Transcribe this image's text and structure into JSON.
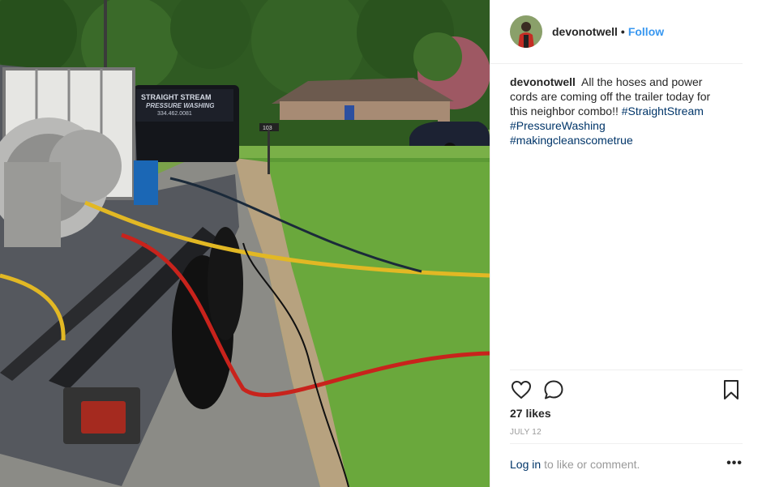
{
  "post": {
    "author": {
      "username": "devonotwell",
      "follow_label": "Follow",
      "separator": "•"
    },
    "caption": {
      "username": "devonotwell",
      "text": "All the hoses and power cords are coming off the trailer today for this neighbor combo!!",
      "hashtags": [
        "#StraightStream",
        "#PressureWashing",
        "#makingcleanscometrue"
      ]
    },
    "image": {
      "trailer_logo_line1": "STRAIGHT STREAM",
      "trailer_logo_line2": "PRESSURE WASHING",
      "trailer_phone": "334.462.0081",
      "mailbox_number": "103"
    },
    "actions": {
      "like_icon": "heart-icon",
      "comment_icon": "comment-icon",
      "save_icon": "bookmark-icon"
    },
    "likes": "27 likes",
    "date": "JULY 12",
    "footer": {
      "login_label": "Log in",
      "login_suffix": "to like or comment.",
      "more_label": "•••"
    }
  },
  "colors": {
    "follow": "#3897f0",
    "link": "#003569",
    "muted": "#999999",
    "text": "#262626",
    "divider": "#efefef"
  }
}
